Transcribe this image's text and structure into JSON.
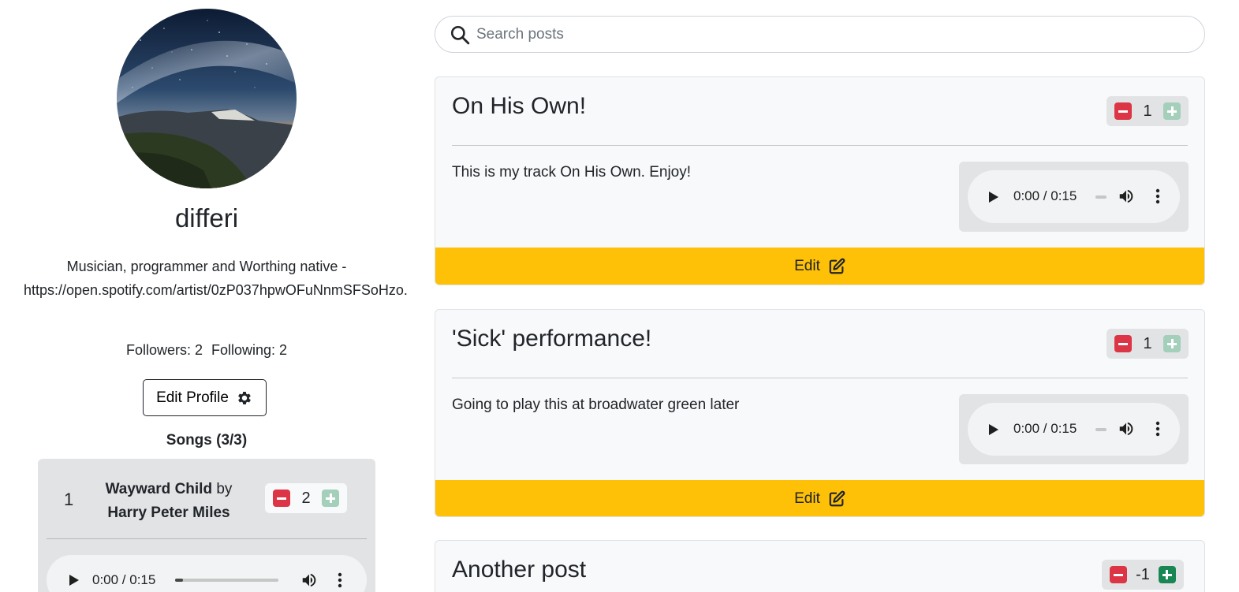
{
  "profile": {
    "username": "differi",
    "bio": "Musician, programmer and Worthing native - https://open.spotify.com/artist/0zP037hpwOFuNnmSFSoHzo.",
    "followers_label": "Followers: 2",
    "following_label": "Following: 2",
    "edit_profile_label": "Edit Profile",
    "avatar_icon": "night-sky-coast-photo"
  },
  "songs": {
    "heading": "Songs (3/3)",
    "items": [
      {
        "number": "1",
        "title": "Wayward Child",
        "by": "by",
        "artist": "Harry Peter Miles",
        "votes": "2",
        "time": "0:00 / 0:15"
      }
    ]
  },
  "search": {
    "placeholder": "Search posts",
    "icon": "search-icon"
  },
  "posts": [
    {
      "title": "On His Own!",
      "votes": "1",
      "body": "This is my track On His Own. Enjoy!",
      "time": "0:00 / 0:15",
      "edit_label": "Edit"
    },
    {
      "title": "'Sick' performance!",
      "votes": "1",
      "body": "Going to play this at broadwater green later",
      "time": "0:00 / 0:15",
      "edit_label": "Edit"
    },
    {
      "title": "Another post",
      "votes": "-1"
    }
  ],
  "colors": {
    "downvote": "#dc3545",
    "upvote_disabled": "#a3cfbb",
    "upvote_active": "#198754",
    "edit_bar": "#ffc107",
    "card_bg": "#f8f9fa",
    "song_card_bg": "#e2e3e5"
  }
}
